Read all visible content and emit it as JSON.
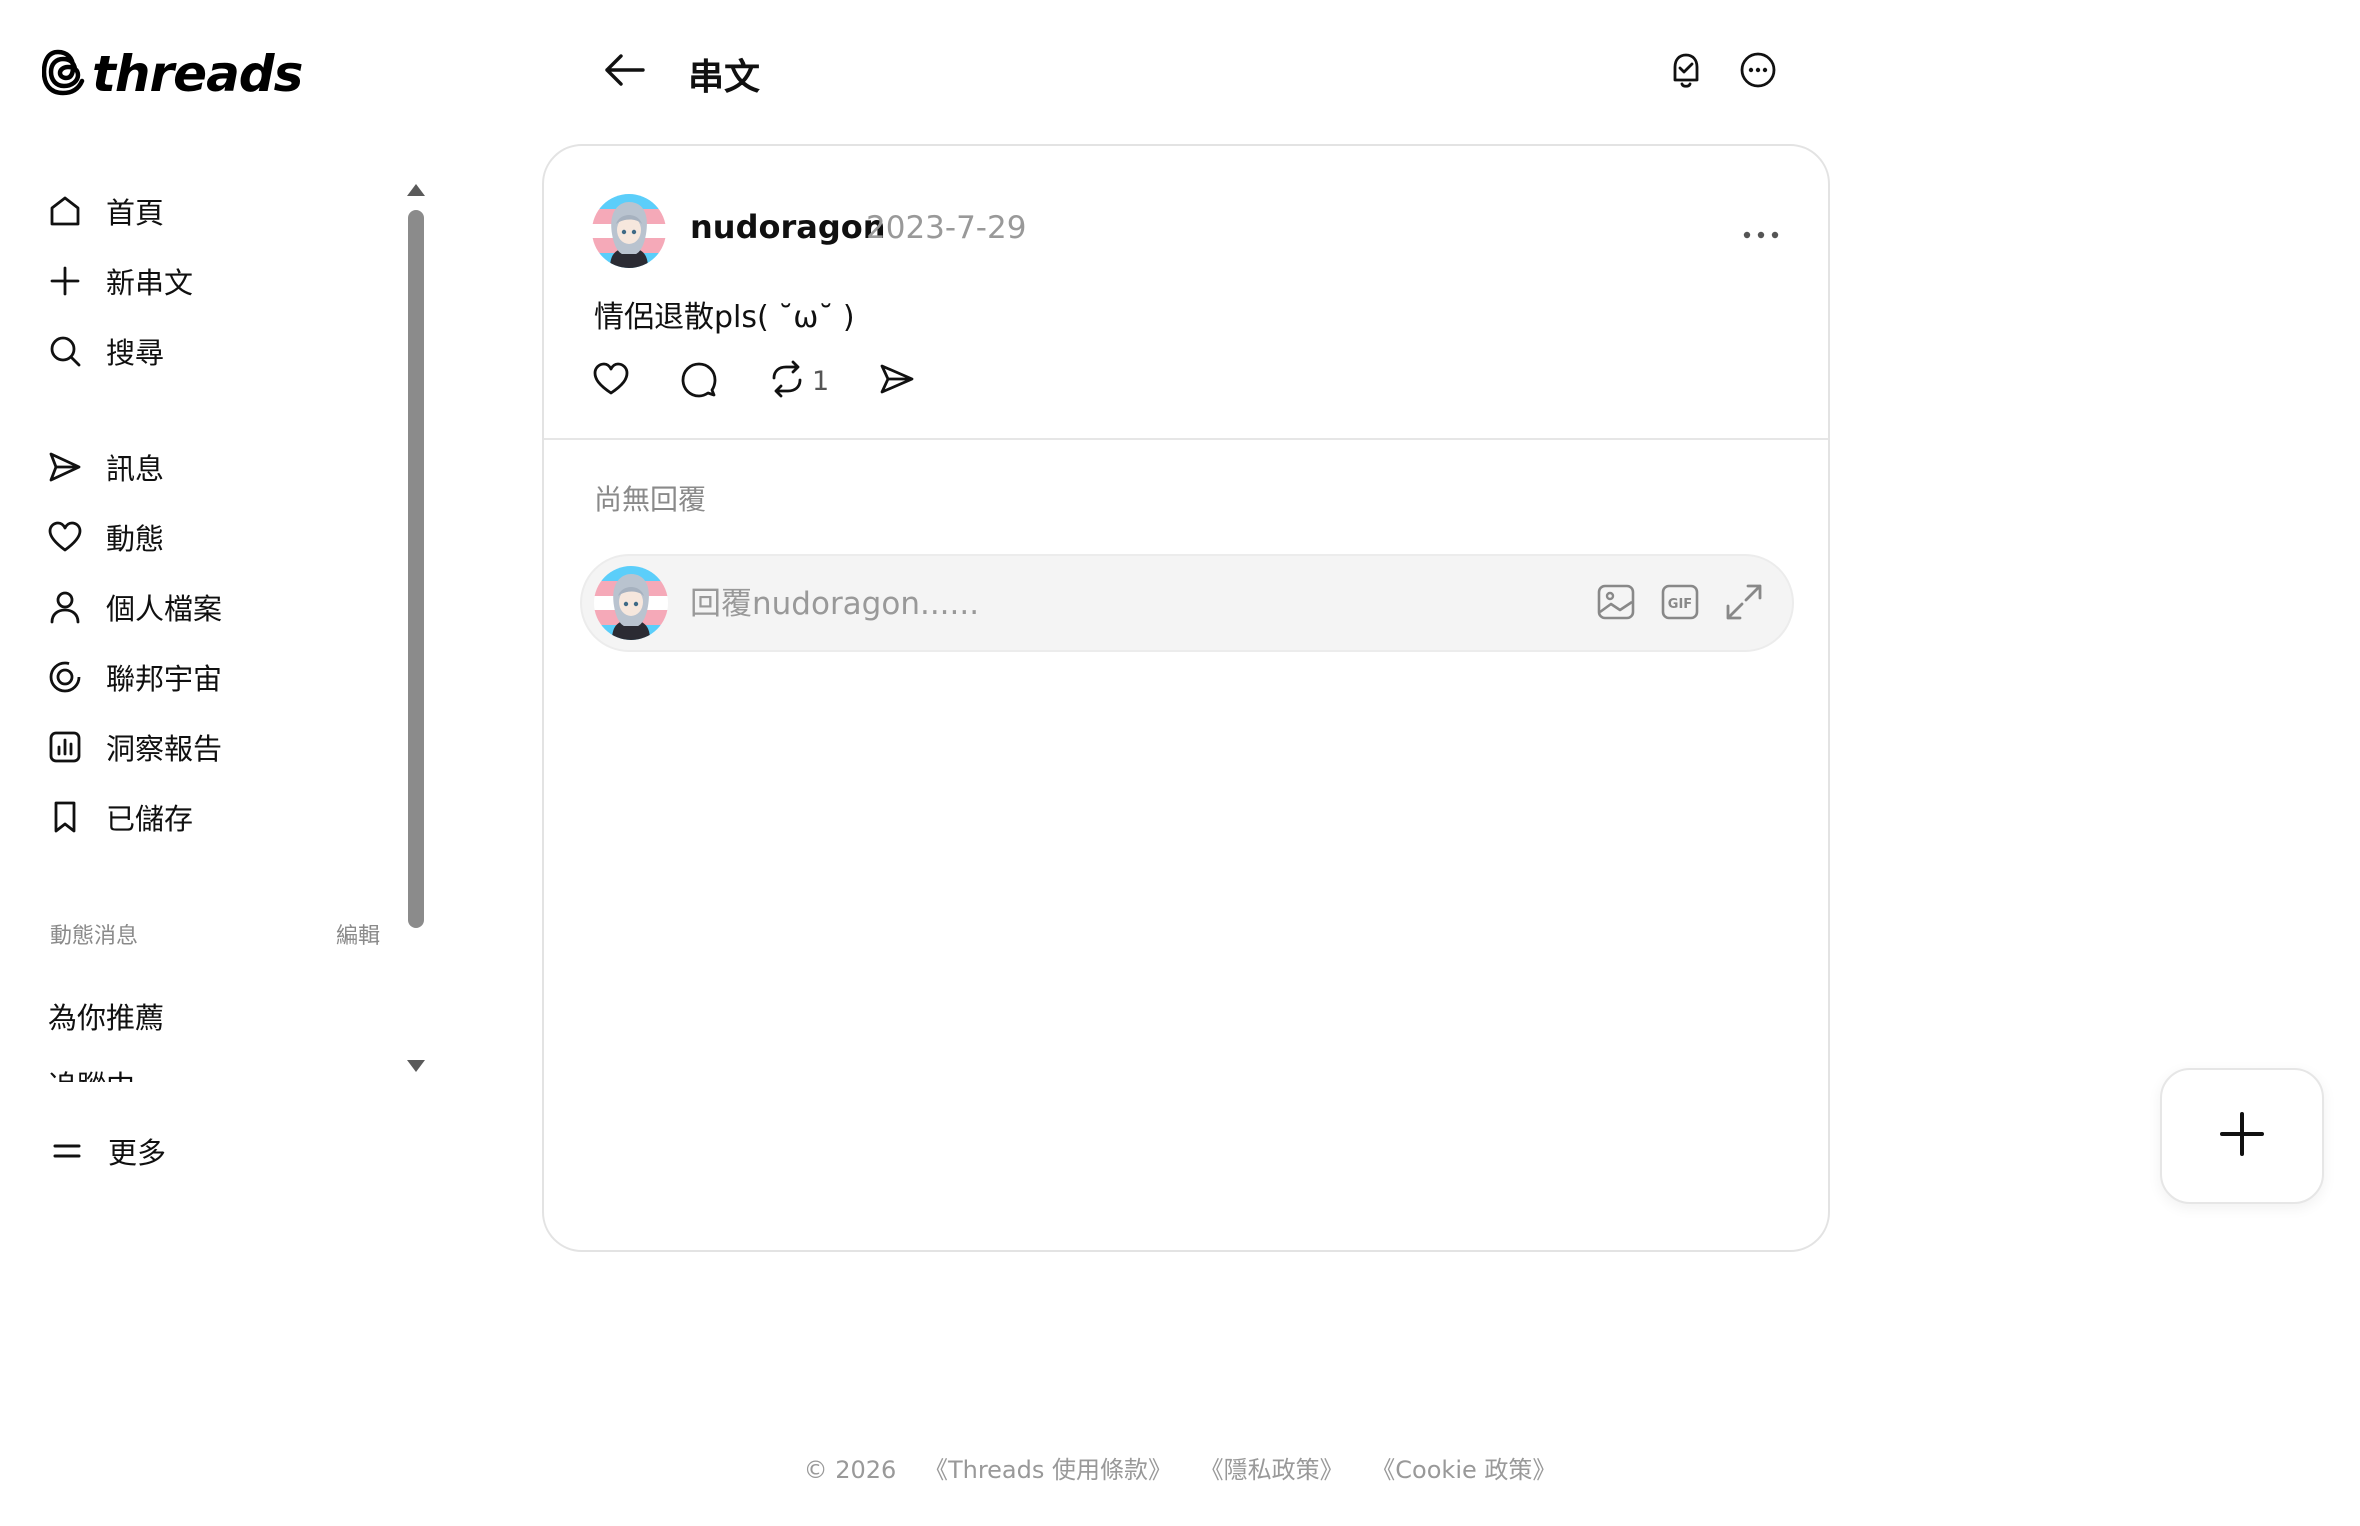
{
  "brand": {
    "wordmark": "threads",
    "icon": "threads-logo-icon"
  },
  "sidebar": {
    "items": [
      {
        "label": "首頁",
        "icon": "home-icon"
      },
      {
        "label": "新串文",
        "icon": "plus-icon"
      },
      {
        "label": "搜尋",
        "icon": "search-icon"
      },
      {
        "label": "訊息",
        "icon": "send-icon"
      },
      {
        "label": "動態",
        "icon": "heart-icon"
      },
      {
        "label": "個人檔案",
        "icon": "person-icon"
      },
      {
        "label": "聯邦宇宙",
        "icon": "fediverse-icon"
      },
      {
        "label": "洞察報告",
        "icon": "insights-icon"
      },
      {
        "label": "已儲存",
        "icon": "bookmark-icon"
      }
    ],
    "feeds_title": "動態消息",
    "feeds_edit": "編輯",
    "feeds": [
      "為你推薦",
      "追蹤中"
    ],
    "more_label": "更多"
  },
  "header": {
    "title": "串文"
  },
  "post": {
    "username": "nudoragon",
    "date": "2023-7-29",
    "text": "情侶退散pls( ˘ω˘ )",
    "repost_count": "1"
  },
  "replies": {
    "empty_text": "尚無回覆",
    "input_placeholder": "回覆nudoragon......"
  },
  "footer": {
    "copyright": "© 2026",
    "links": [
      "《Threads 使用條款》",
      "《隱私政策》",
      "《Cookie 政策》"
    ]
  }
}
